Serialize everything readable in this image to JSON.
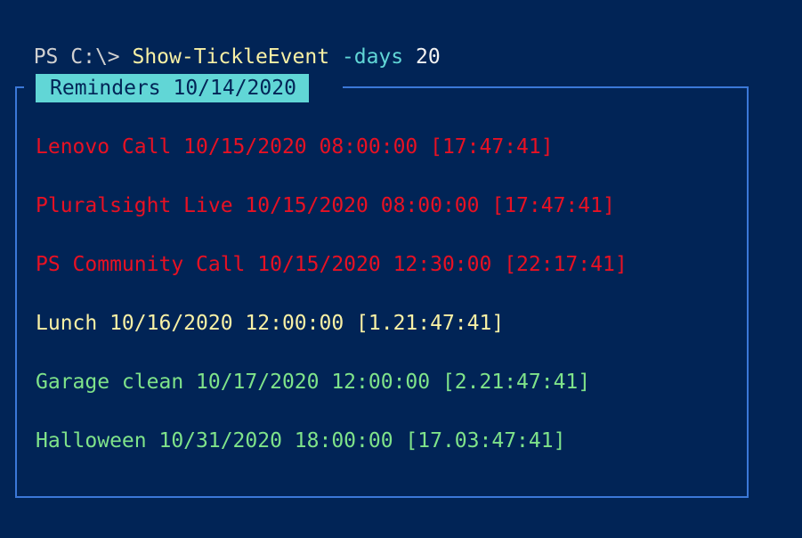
{
  "console": {
    "prompt": "PS C:\\> ",
    "command": "Show-TickleEvent",
    "parameter": " -days",
    "argument": " 20"
  },
  "panel": {
    "title": "Reminders 10/14/2020"
  },
  "reminders": [
    {
      "text": "Lenovo Call 10/15/2020 08:00:00 [17:47:41]"
    },
    {
      "text": "Pluralsight Live 10/15/2020 08:00:00 [17:47:41]"
    },
    {
      "text": "PS Community Call 10/15/2020 12:30:00 [22:17:41]"
    },
    {
      "text": "Lunch 10/16/2020 12:00:00 [1.21:47:41]"
    },
    {
      "text": "Garage clean 10/17/2020 12:00:00 [2.21:47:41]"
    },
    {
      "text": "Halloween 10/31/2020 18:00:00 [17.03:47:41]"
    }
  ],
  "colors": {
    "background": "#012456",
    "border": "#3b78d8",
    "title_bg": "#61d6d6",
    "urgent": "#e81123",
    "soon": "#f9f1a5",
    "later": "#7fe38a"
  }
}
